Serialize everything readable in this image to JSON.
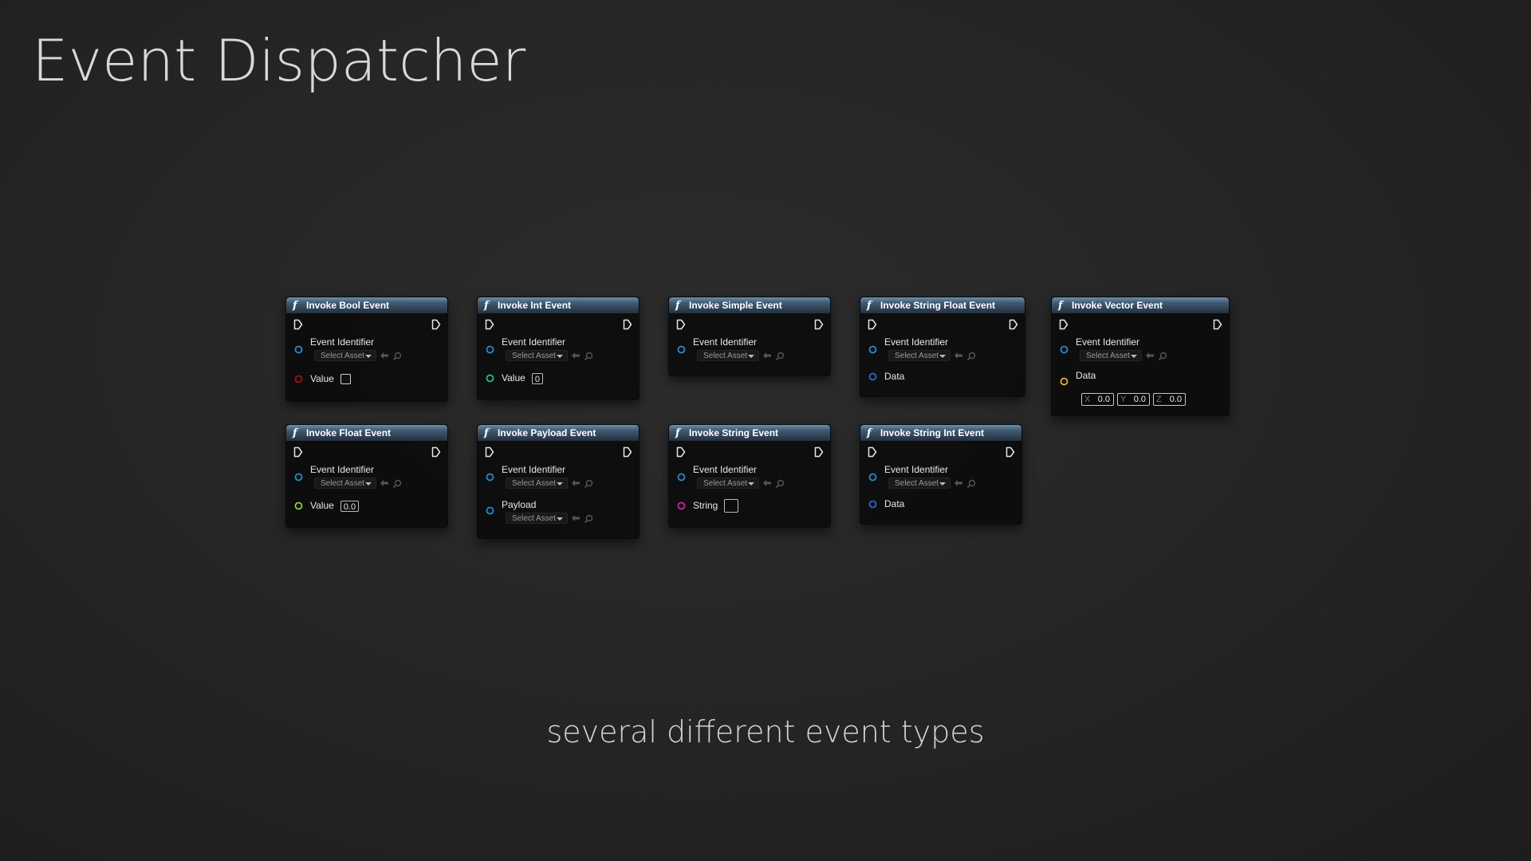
{
  "title": "Event Dispatcher",
  "subtitle": "several different event types",
  "colors": {
    "exec": "#e6e6e6",
    "object_pin": "#1b8fd6",
    "bool_pin": "#a31111",
    "int_pin": "#1ebf93",
    "float_pin": "#8ad53b",
    "string_pin": "#e01ab5",
    "struct_pin": "#1b6fd6",
    "vector_pin": "#e8b02a"
  },
  "labels": {
    "event_identifier": "Event Identifier",
    "select_asset": "Select Asset"
  },
  "nodes": {
    "bool": {
      "title": "Invoke Bool Event",
      "pin_label": "Value"
    },
    "int": {
      "title": "Invoke Int Event",
      "pin_label": "Value",
      "value": "0"
    },
    "simple": {
      "title": "Invoke Simple Event"
    },
    "string_float": {
      "title": "Invoke String Float Event",
      "pin_label": "Data"
    },
    "vector": {
      "title": "Invoke Vector Event",
      "pin_label": "Data",
      "x_label": "X",
      "x": "0.0",
      "y_label": "Y",
      "y": "0.0",
      "z_label": "Z",
      "z": "0.0"
    },
    "float": {
      "title": "Invoke Float Event",
      "pin_label": "Value",
      "value": "0.0"
    },
    "payload": {
      "title": "Invoke Payload Event",
      "pin_label": "Payload"
    },
    "string": {
      "title": "Invoke String Event",
      "pin_label": "String"
    },
    "string_int": {
      "title": "Invoke String Int Event",
      "pin_label": "Data"
    }
  }
}
